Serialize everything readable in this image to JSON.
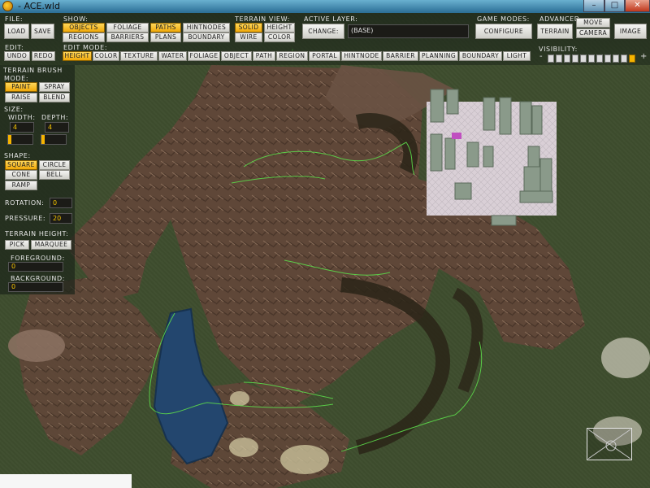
{
  "window": {
    "title": "- ACE.wld"
  },
  "titlebar_buttons": {
    "minimize": "–",
    "maximize": "□",
    "close": "✕"
  },
  "toolbar": {
    "file": {
      "label": "FILE:",
      "load": "LOAD",
      "save": "SAVE"
    },
    "show": {
      "label": "SHOW:",
      "objects": "OBJECTS",
      "foliage": "FOLIAGE",
      "paths": "PATHS",
      "hintnodes": "HINTNODES",
      "regions": "REGIONS",
      "barriers": "BARRIERS",
      "plans": "PLANS",
      "boundary": "BOUNDARY"
    },
    "terrain_view": {
      "label": "TERRAIN VIEW:",
      "solid": "SOLID",
      "height": "HEIGHT",
      "wire": "WIRE",
      "color": "COLOR"
    },
    "active_layer": {
      "label": "ACTIVE LAYER:",
      "change": "CHANGE:",
      "value": "(BASE)"
    },
    "game_modes": {
      "label": "GAME MODES:",
      "configure": "CONFIGURE"
    },
    "advanced": {
      "label": "ADVANCED",
      "terrain": "TERRAIN",
      "move": "MOVE",
      "camera": "CAMERA",
      "image": "IMAGE"
    },
    "edit": {
      "label": "EDIT:",
      "undo": "UNDO",
      "redo": "REDO"
    },
    "edit_mode": {
      "label": "EDIT MODE:",
      "modes": [
        "HEIGHT",
        "COLOR",
        "TEXTURE",
        "WATER",
        "FOLIAGE",
        "OBJECT",
        "PATH",
        "REGION",
        "PORTAL",
        "HINTNODE",
        "BARRIER",
        "PLANNING",
        "BOUNDARY",
        "LIGHT"
      ],
      "active": "HEIGHT"
    },
    "visibility": {
      "label": "VISIBILITY:",
      "minus": "-",
      "plus": "+",
      "level": 10,
      "max": 11
    }
  },
  "panel": {
    "title": "TERRAIN BRUSH",
    "mode": {
      "label": "MODE:",
      "paint": "PAINT",
      "spray": "SPRAY",
      "raise": "RAISE",
      "blend": "BLEND"
    },
    "size": {
      "label": "SIZE:",
      "width_label": "WIDTH:",
      "width": "4",
      "depth_label": "DEPTH:",
      "depth": "4"
    },
    "shape": {
      "label": "SHAPE:",
      "square": "SQUARE",
      "circle": "CIRCLE",
      "cone": "CONE",
      "bell": "BELL",
      "ramp": "RAMP"
    },
    "rotation": {
      "label": "ROTATION:",
      "value": "0"
    },
    "pressure": {
      "label": "PRESSURE:",
      "value": "20"
    },
    "terrain_height": {
      "label": "TERRAIN HEIGHT:",
      "pick": "PICK",
      "marquee": "MARQUEE",
      "foreground_label": "FOREGROUND:",
      "foreground": "0",
      "background_label": "BACKGROUND:",
      "background": "0"
    }
  },
  "colors": {
    "active": "#f5b400",
    "grass": "#3e4d2e",
    "rock": "#6b5040",
    "water": "#23466e",
    "path": "#5cd94a"
  }
}
